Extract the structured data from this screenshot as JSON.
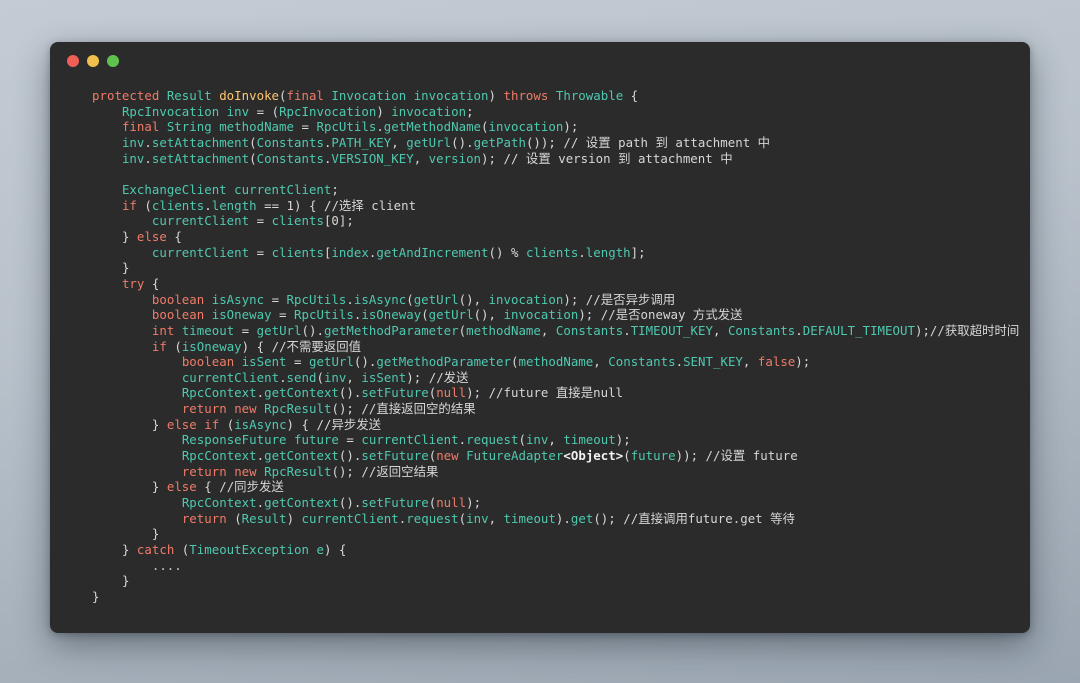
{
  "window": {
    "controls": [
      {
        "name": "close",
        "color": "#ef5f56"
      },
      {
        "name": "minimize",
        "color": "#f0bf4c"
      },
      {
        "name": "maximize",
        "color": "#5fc14e"
      }
    ],
    "background": "#2b2b2b",
    "page_background": "#b9c2cb"
  },
  "editor": {
    "language": "Java",
    "theme": "dark",
    "colors": {
      "keyword": "#ef7b68",
      "type": "#4ec9b0",
      "method_name": "#ffc66d",
      "comment": "#d6d6d6",
      "plain": "#d8d8d8",
      "generic": "#f2f2f2",
      "background": "#2b2b2b"
    },
    "lines": [
      "protected Result doInvoke(final Invocation invocation) throws Throwable {",
      "    RpcInvocation inv = (RpcInvocation) invocation;",
      "    final String methodName = RpcUtils.getMethodName(invocation);",
      "    inv.setAttachment(Constants.PATH_KEY, getUrl().getPath()); // 设置 path 到 attachment 中",
      "    inv.setAttachment(Constants.VERSION_KEY, version); // 设置 version 到 attachment 中",
      "",
      "    ExchangeClient currentClient;",
      "    if (clients.length == 1) { //选择 client",
      "        currentClient = clients[0];",
      "    } else {",
      "        currentClient = clients[index.getAndIncrement() % clients.length];",
      "    }",
      "    try {",
      "        boolean isAsync = RpcUtils.isAsync(getUrl(), invocation); //是否异步调用",
      "        boolean isOneway = RpcUtils.isOneway(getUrl(), invocation); //是否oneway 方式发送",
      "        int timeout = getUrl().getMethodParameter(methodName, Constants.TIMEOUT_KEY, Constants.DEFAULT_TIMEOUT);//获取超时时间",
      "        if (isOneway) { //不需要返回值",
      "            boolean isSent = getUrl().getMethodParameter(methodName, Constants.SENT_KEY, false);",
      "            currentClient.send(inv, isSent); //发送",
      "            RpcContext.getContext().setFuture(null); //future 直接是null",
      "            return new RpcResult(); //直接返回空的结果",
      "        } else if (isAsync) { //异步发送",
      "            ResponseFuture future = currentClient.request(inv, timeout);",
      "            RpcContext.getContext().setFuture(new FutureAdapter<Object>(future)); //设置 future",
      "            return new RpcResult(); //返回空结果",
      "        } else { //同步发送",
      "            RpcContext.getContext().setFuture(null);",
      "            return (Result) currentClient.request(inv, timeout).get(); //直接调用future.get 等待",
      "        }",
      "    } catch (TimeoutException e) {",
      "        ....",
      "    }",
      "}"
    ]
  }
}
